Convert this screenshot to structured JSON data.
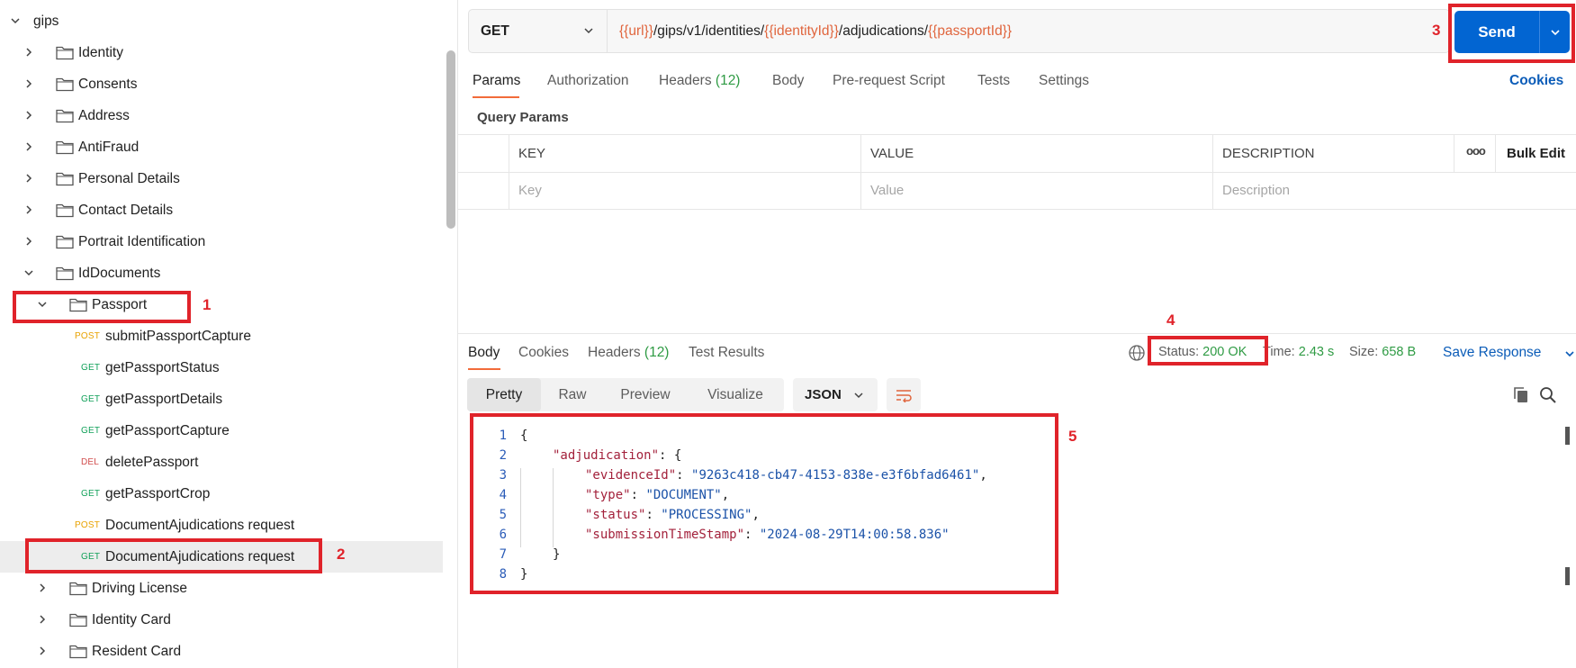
{
  "sidebar": {
    "root": {
      "label": "gips"
    },
    "items": [
      {
        "label": "Identity"
      },
      {
        "label": "Consents"
      },
      {
        "label": "Address"
      },
      {
        "label": "AntiFraud"
      },
      {
        "label": "Personal Details"
      },
      {
        "label": "Contact Details"
      },
      {
        "label": "Portrait Identification"
      },
      {
        "label": "IdDocuments"
      },
      {
        "label": "Passport"
      },
      {
        "label": "Driving License"
      },
      {
        "label": "Identity Card"
      },
      {
        "label": "Resident Card"
      }
    ],
    "requests": [
      {
        "method": "POST",
        "label": "submitPassportCapture"
      },
      {
        "method": "GET",
        "label": "getPassportStatus"
      },
      {
        "method": "GET",
        "label": "getPassportDetails"
      },
      {
        "method": "GET",
        "label": "getPassportCapture"
      },
      {
        "method": "DEL",
        "label": "deletePassport"
      },
      {
        "method": "GET",
        "label": "getPassportCrop"
      },
      {
        "method": "POST",
        "label": "DocumentAjudications request"
      },
      {
        "method": "GET",
        "label": "DocumentAjudications request"
      }
    ]
  },
  "request": {
    "method": "GET",
    "url_parts": [
      "{{url}}",
      "/gips/v1/identities/",
      "{{identityId}}",
      "/adjudications/",
      "{{passportId}}"
    ],
    "send_label": "Send"
  },
  "tabs": [
    {
      "label": "Params"
    },
    {
      "label": "Authorization"
    },
    {
      "label": "Headers",
      "count": "(12)"
    },
    {
      "label": "Body"
    },
    {
      "label": "Pre-request Script"
    },
    {
      "label": "Tests"
    },
    {
      "label": "Settings"
    }
  ],
  "cookies_label": "Cookies",
  "query_params": {
    "title": "Query Params",
    "columns": [
      "KEY",
      "VALUE",
      "DESCRIPTION"
    ],
    "more_icon": "ooo",
    "bulk_edit": "Bulk Edit",
    "placeholders": [
      "Key",
      "Value",
      "Description"
    ]
  },
  "response": {
    "tabs": [
      {
        "label": "Body"
      },
      {
        "label": "Cookies"
      },
      {
        "label": "Headers",
        "count": "(12)"
      },
      {
        "label": "Test Results"
      }
    ],
    "status_label": "Status:",
    "status_value": "200 OK",
    "time_label": "Time:",
    "time_value": "2.43 s",
    "size_label": "Size:",
    "size_value": "658 B",
    "save_label": "Save Response",
    "views": [
      "Pretty",
      "Raw",
      "Preview",
      "Visualize"
    ],
    "format": "JSON",
    "lines": [
      "1",
      "2",
      "3",
      "4",
      "5",
      "6",
      "7",
      "8"
    ],
    "code": {
      "open": "{",
      "adjudication_key": "\"adjudication\"",
      "colon_brace": ": {",
      "evidence_key": "\"evidenceId\"",
      "evidence_val": "\"9263c418-cb47-4153-838e-e3f6bfad6461\"",
      "type_key": "\"type\"",
      "type_val": "\"DOCUMENT\"",
      "status_key": "\"status\"",
      "status_val": "\"PROCESSING\"",
      "ts_key": "\"submissionTimeStamp\"",
      "ts_val": "\"2024-08-29T14:00:58.836\"",
      "inner_close": "}",
      "close": "}"
    }
  },
  "annotations": [
    "1",
    "2",
    "3",
    "4",
    "5"
  ],
  "colors": {
    "accent": "#0265d2",
    "annotation": "#e0232a",
    "tab_underline": "#f26b3a",
    "get": "#12a15a",
    "post": "#e8a200",
    "del": "#d14e4e"
  }
}
